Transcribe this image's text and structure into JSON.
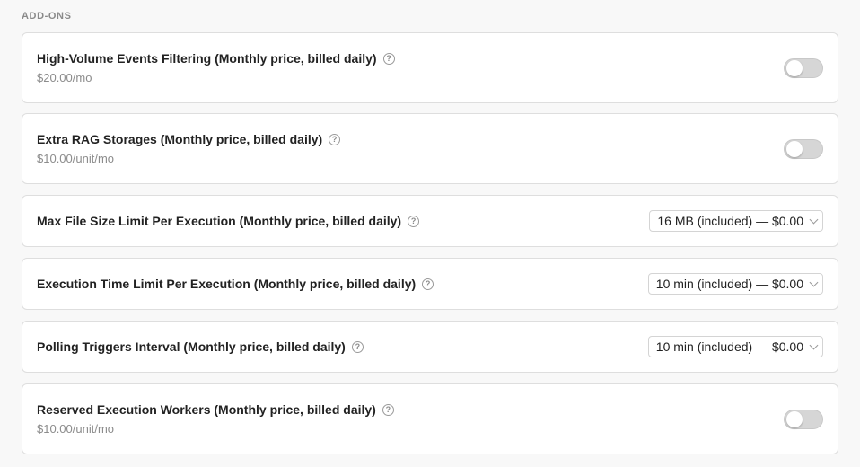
{
  "section": {
    "title": "ADD-ONS"
  },
  "addons": [
    {
      "name": "High-Volume Events Filtering (Monthly price, billed daily)",
      "price": "$20.00/mo",
      "control": "toggle",
      "enabled": false
    },
    {
      "name": "Extra RAG Storages (Monthly price, billed daily)",
      "price": "$10.00/unit/mo",
      "control": "toggle",
      "enabled": false
    },
    {
      "name": "Max File Size Limit Per Execution (Monthly price, billed daily)",
      "control": "select",
      "selected": "16 MB (included) — $0.00"
    },
    {
      "name": "Execution Time Limit Per Execution (Monthly price, billed daily)",
      "control": "select",
      "selected": "10 min (included) — $0.00"
    },
    {
      "name": "Polling Triggers Interval (Monthly price, billed daily)",
      "control": "select",
      "selected": "10 min (included) — $0.00"
    },
    {
      "name": "Reserved Execution Workers (Monthly price, billed daily)",
      "price": "$10.00/unit/mo",
      "control": "toggle",
      "enabled": false
    }
  ],
  "icons": {
    "help": "help-circle-icon",
    "help_glyph": "?",
    "dropdown": "chevron-down-icon"
  }
}
